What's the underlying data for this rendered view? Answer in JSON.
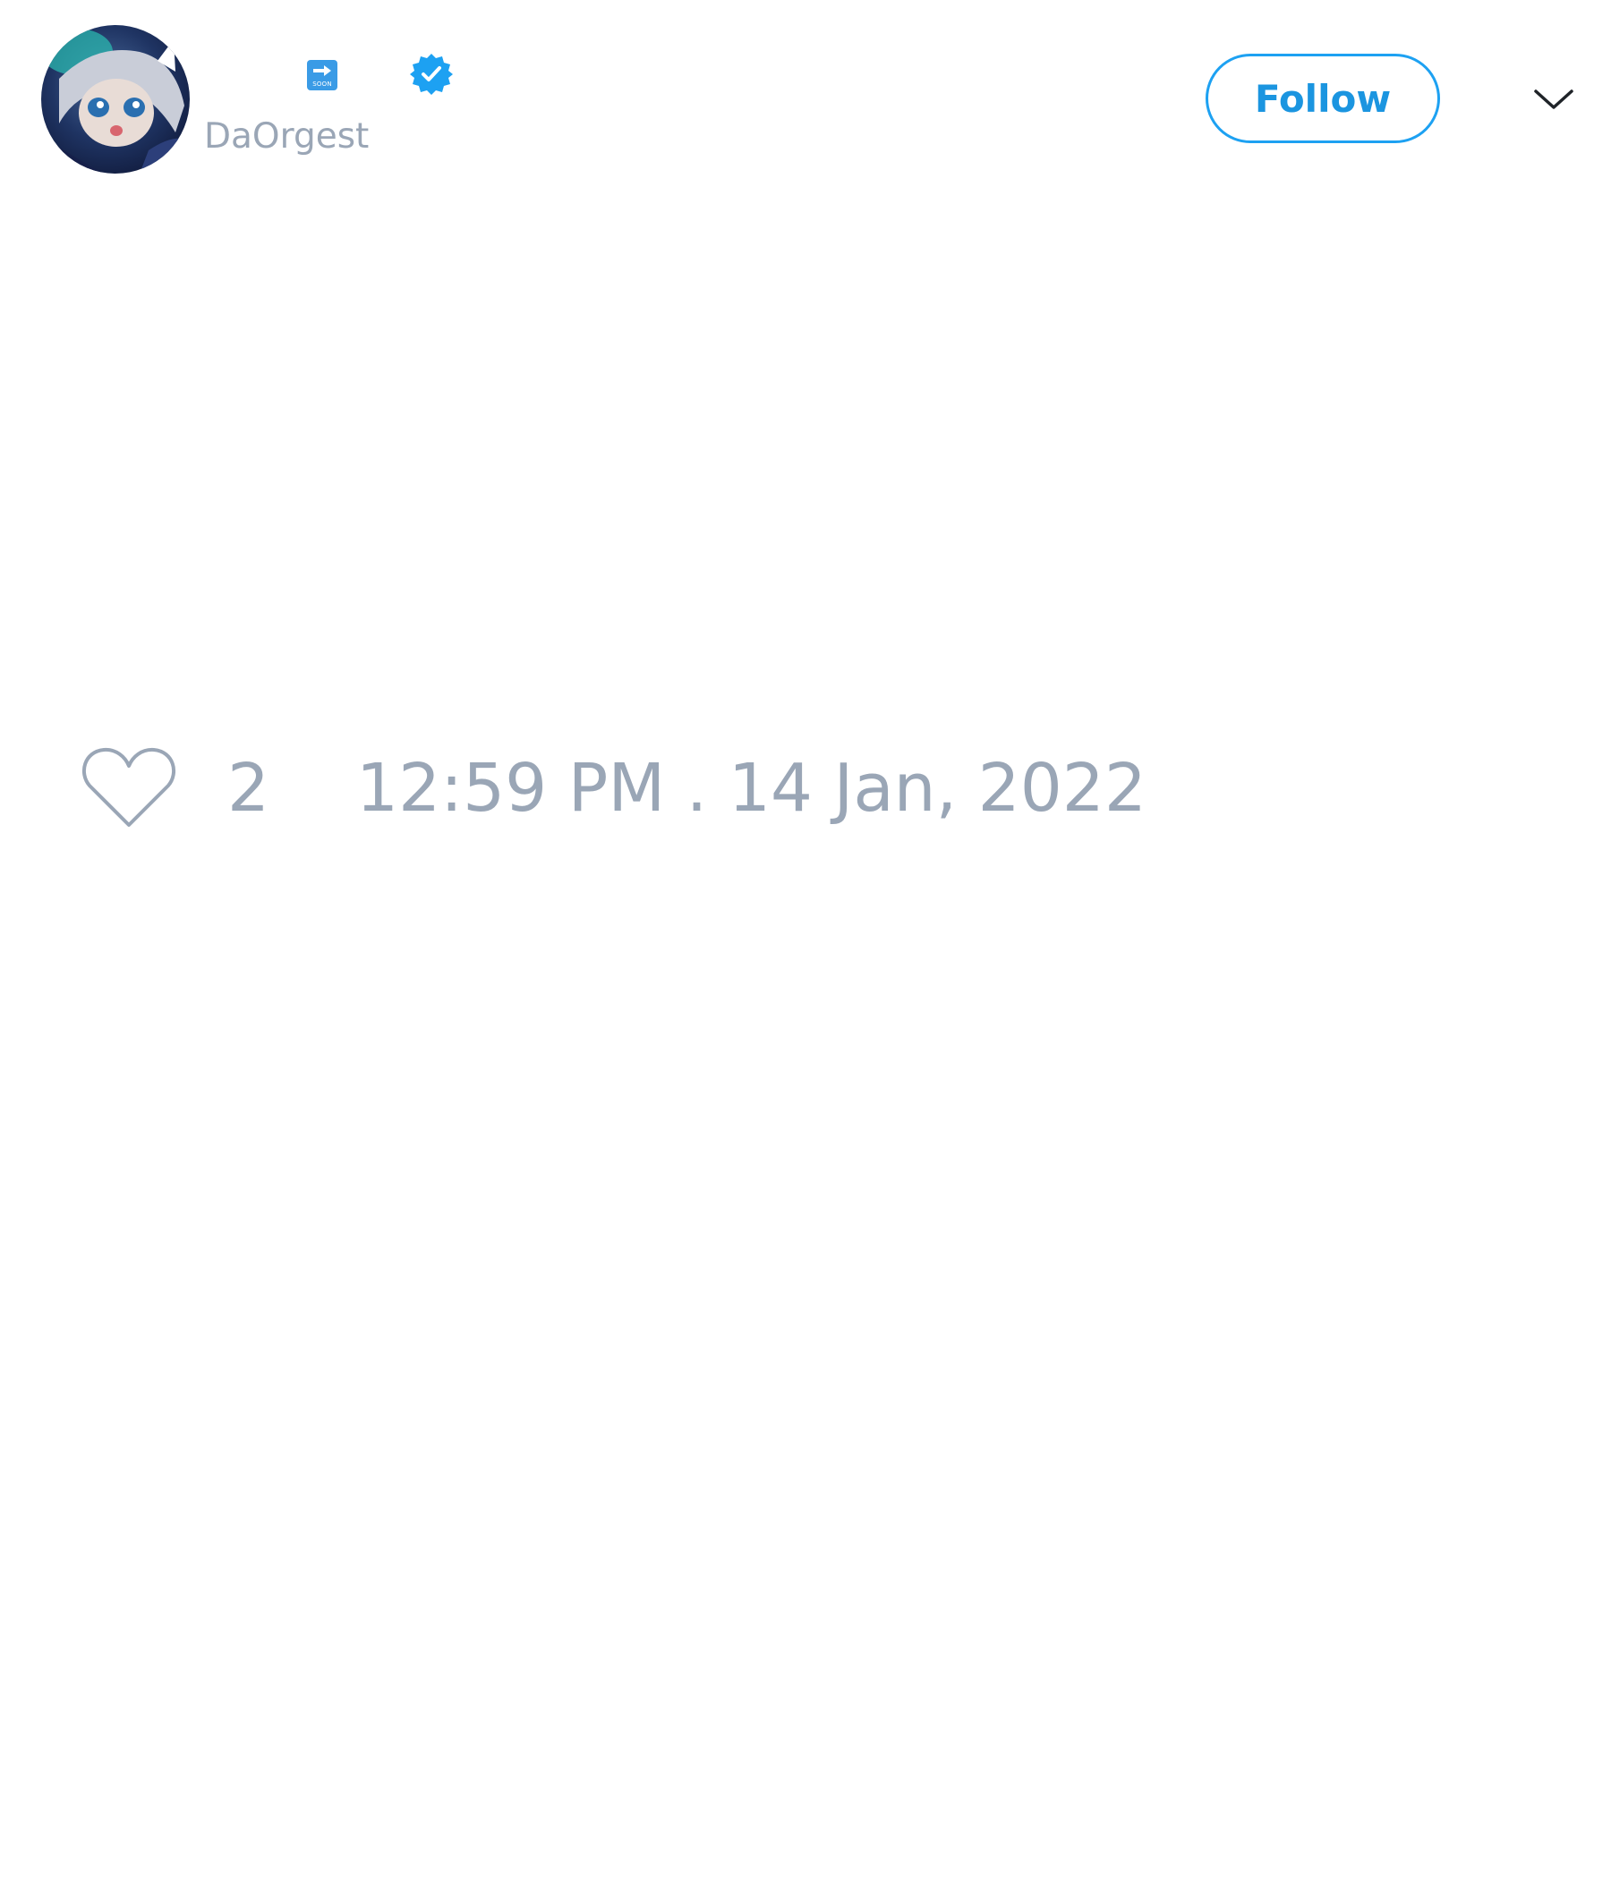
{
  "header": {
    "handle": "DaOrgest",
    "soon_badge_text": "SOON",
    "follow_label": "Follow"
  },
  "footer": {
    "like_count": "2",
    "timestamp": "12:59 PM . 14 Jan, 2022"
  },
  "icons": {
    "avatar": "avatar-image",
    "soon": "soon-arrow-icon",
    "verified": "verified-badge-icon",
    "menu": "chevron-down-icon",
    "like": "heart-icon"
  },
  "colors": {
    "accent": "#1da1f2",
    "follow_text": "#1b95e0",
    "muted_text": "#9aa6b6",
    "background": "#ffffff"
  }
}
